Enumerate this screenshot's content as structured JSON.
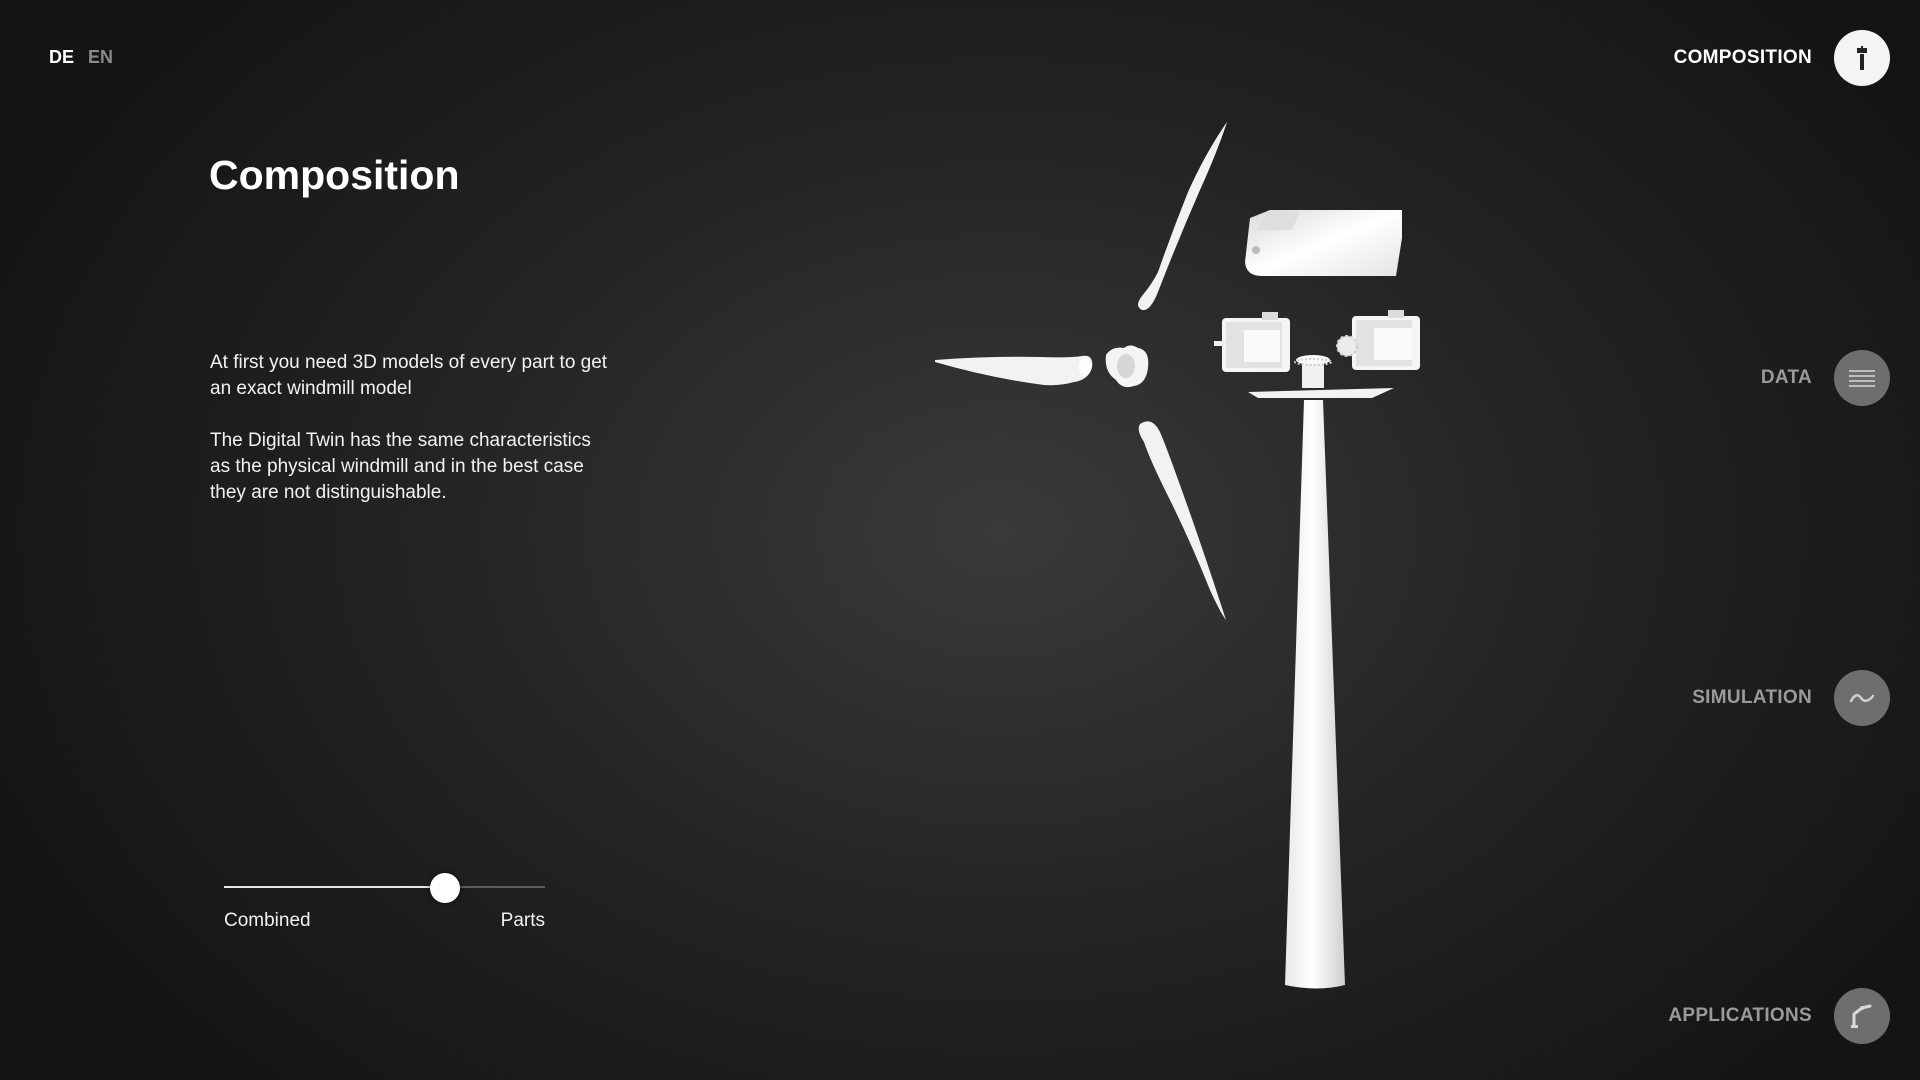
{
  "language": {
    "de": "DE",
    "en": "EN",
    "active": "DE"
  },
  "section": {
    "title": "Composition",
    "paragraphs": [
      "At first you need 3D models of every part to get an exact windmill model",
      "The Digital Twin has the same characteristics as the physical windmill and in the best case they are not distinguishable."
    ]
  },
  "slider": {
    "left_label": "Combined",
    "right_label": "Parts",
    "value_percent": 69
  },
  "nav": [
    {
      "label": "COMPOSITION",
      "icon": "windmill-icon",
      "active": true
    },
    {
      "label": "DATA",
      "icon": "binary-data-icon",
      "active": false
    },
    {
      "label": "SIMULATION",
      "icon": "wave-icon",
      "active": false
    },
    {
      "label": "APPLICATIONS",
      "icon": "robot-arm-icon",
      "active": false
    }
  ],
  "colors": {
    "background": "#242424",
    "text": "#ffffff",
    "inactive": "#9a9a9a",
    "model": "#f4f4f4"
  }
}
